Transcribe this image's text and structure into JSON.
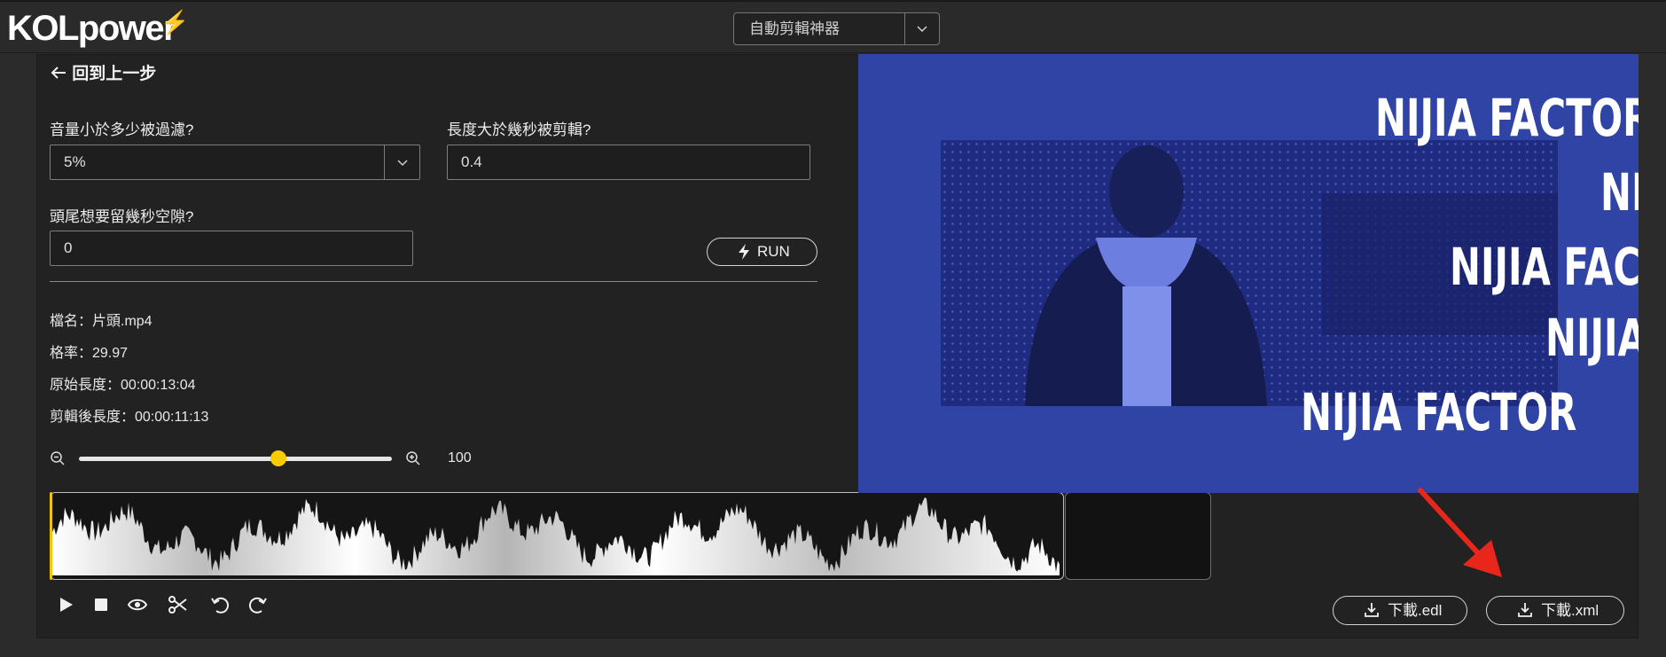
{
  "header": {
    "logo_text": "KOLpower",
    "tool_select": {
      "selected": "自動剪輯神器"
    }
  },
  "nav": {
    "back_label": "回到上一步"
  },
  "form": {
    "volume_label": "音量小於多少被過濾?",
    "volume_value": "5%",
    "length_label": "長度大於幾秒被剪輯?",
    "length_value": "0.4",
    "padding_label": "頭尾想要留幾秒空隙?",
    "padding_value": "0",
    "run_label": "RUN"
  },
  "file_info": {
    "name": "檔名：片頭.mp4",
    "framerate": "格率：29.97",
    "original_length": "原始長度：00:00:13:04",
    "edited_length": "剪輯後長度：00:00:11:13"
  },
  "zoom": {
    "value": "100",
    "level_fraction": 0.63
  },
  "video_preview": {
    "overlay_lines": [
      "NIJIA FACTOR",
      "NI",
      "NIJIA FAC",
      "NIJIA",
      "NIJIA FACTOR"
    ]
  },
  "downloads": {
    "edl_label": "下載.edl",
    "xml_label": "下載.xml"
  },
  "colors": {
    "accent_yellow": "#f5c400",
    "video_blue": "#2f44a4",
    "arrow_red": "#e8261c",
    "panel_bg": "#222222"
  },
  "icons": {
    "back": "arrow-left-icon",
    "select": "chevron-down-icon",
    "run": "lightning-icon",
    "zoom_out": "zoom-out-icon",
    "zoom_in": "zoom-in-icon",
    "play": "play-icon",
    "stop": "stop-icon",
    "preview": "eye-icon",
    "cut": "scissors-icon",
    "undo": "undo-icon",
    "redo": "redo-icon",
    "download": "download-icon"
  }
}
